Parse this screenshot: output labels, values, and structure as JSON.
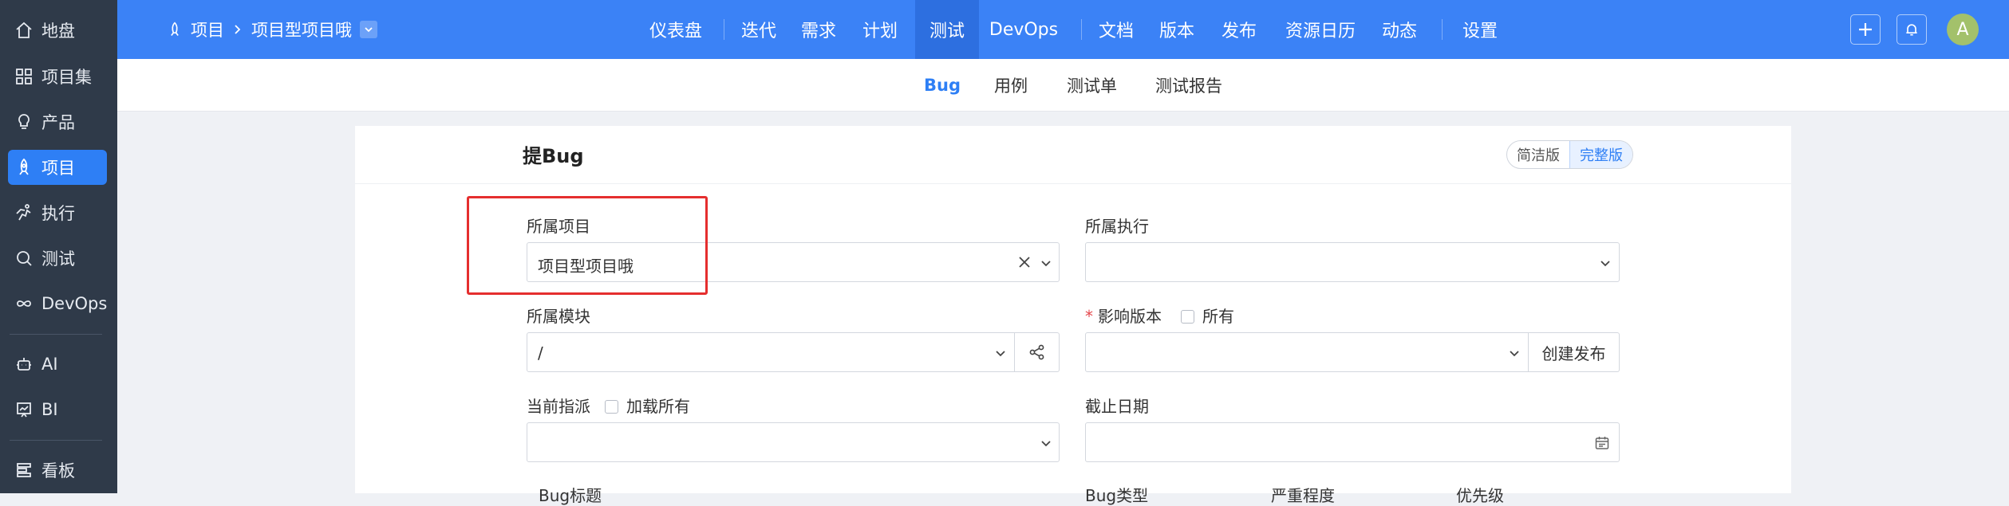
{
  "sidebar": {
    "items": [
      {
        "label": "地盘",
        "icon": "home-icon"
      },
      {
        "label": "项目集",
        "icon": "grid-icon"
      },
      {
        "label": "产品",
        "icon": "bulb-icon"
      },
      {
        "label": "项目",
        "icon": "rocket-icon"
      },
      {
        "label": "执行",
        "icon": "run-icon"
      },
      {
        "label": "测试",
        "icon": "search-icon"
      },
      {
        "label": "DevOps",
        "icon": "infinity-icon"
      },
      {
        "label": "AI",
        "icon": "robot-icon"
      },
      {
        "label": "BI",
        "icon": "chart-board-icon"
      },
      {
        "label": "看板",
        "icon": "kanban-icon"
      }
    ],
    "active": "项目"
  },
  "topbar": {
    "breadcrumb_root": "项目",
    "breadcrumb_current": "项目型项目哦",
    "nav": [
      "仪表盘",
      "迭代",
      "需求",
      "计划",
      "测试",
      "DevOps",
      "文档",
      "版本",
      "发布",
      "资源日历",
      "动态",
      "设置"
    ],
    "active_nav": "测试",
    "avatar_letter": "A",
    "colors": {
      "bar": "#3b82f6",
      "active": "#2d6fe0",
      "sidebar": "#2f3a49",
      "accent": "#2e7ff5"
    }
  },
  "subnav": {
    "items": [
      "Bug",
      "用例",
      "测试单",
      "测试报告"
    ],
    "active": "Bug"
  },
  "form": {
    "title": "提Bug",
    "mode_simple": "简洁版",
    "mode_full": "完整版",
    "project_label": "所属项目",
    "project_value": "项目型项目哦",
    "execution_label": "所属执行",
    "execution_value": "",
    "module_label": "所属模块",
    "module_value": "/",
    "version_label": "影响版本",
    "version_all": "所有",
    "create_release": "创建发布",
    "assign_label": "当前指派",
    "load_all": "加载所有",
    "deadline_label": "截止日期",
    "bug_title_label": "Bug标题",
    "bug_type_label": "Bug类型",
    "severity_label": "严重程度",
    "priority_label": "优先级"
  }
}
